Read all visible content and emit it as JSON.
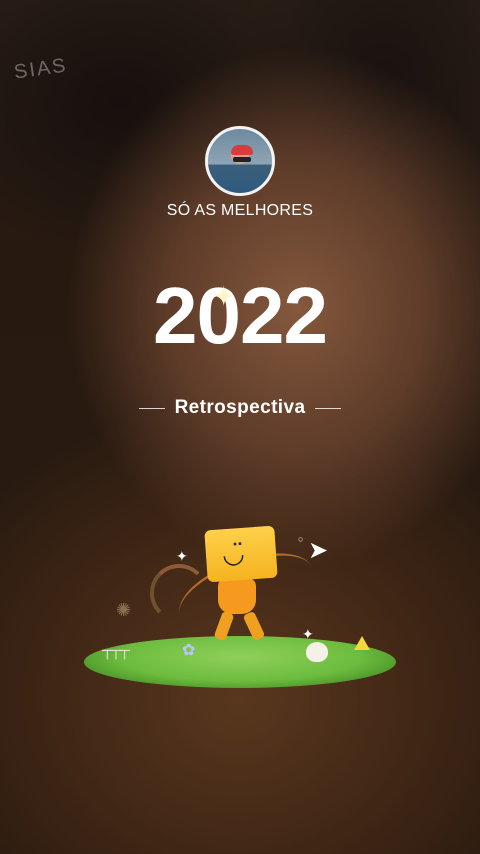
{
  "watermark_text": "SIAS",
  "profile": {
    "channel_name": "SÓ AS MELHORES",
    "avatar_icon": "profile-photo"
  },
  "headline": {
    "year": "2022",
    "subtitle": "Retrospectiva"
  },
  "illustration": {
    "icons": [
      "box-character-icon",
      "paper-plane-icon",
      "sparkle-icon",
      "island-icon"
    ]
  },
  "colors": {
    "text": "#ffffff",
    "character": "#f5b320"
  }
}
